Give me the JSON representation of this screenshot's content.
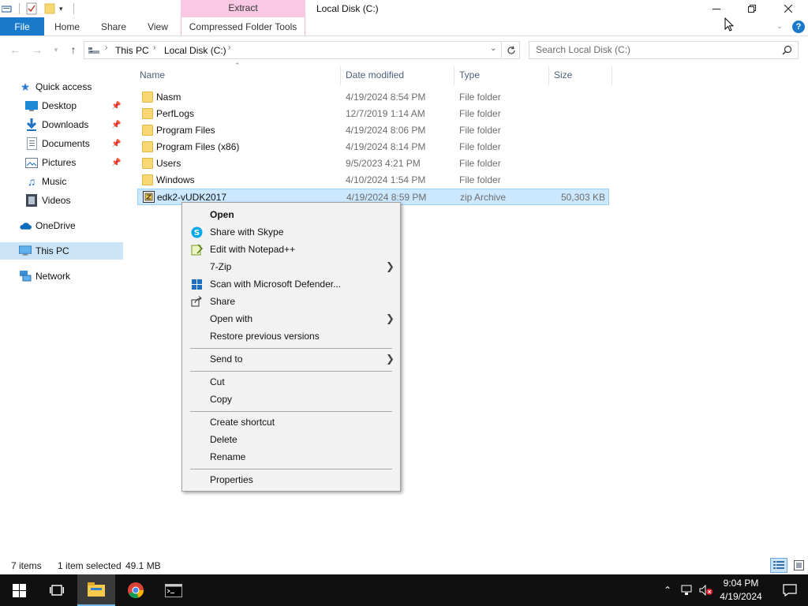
{
  "window": {
    "title": "Local Disk (C:)",
    "contextual_group": "Extract"
  },
  "ribbon": {
    "tabs": [
      {
        "label": "File"
      },
      {
        "label": "Home"
      },
      {
        "label": "Share"
      },
      {
        "label": "View"
      },
      {
        "label": "Compressed Folder Tools"
      }
    ]
  },
  "address": {
    "segments": [
      "This PC",
      "Local Disk (C:)"
    ]
  },
  "search": {
    "placeholder": "Search Local Disk (C:)"
  },
  "columns": {
    "name": "Name",
    "date": "Date modified",
    "type": "Type",
    "size": "Size"
  },
  "nav": {
    "quick_access": "Quick access",
    "items": [
      {
        "label": "Desktop",
        "icon": "desktop-icon"
      },
      {
        "label": "Downloads",
        "icon": "downloads-icon"
      },
      {
        "label": "Documents",
        "icon": "documents-icon"
      },
      {
        "label": "Pictures",
        "icon": "pictures-icon"
      },
      {
        "label": "Music",
        "icon": "music-icon"
      },
      {
        "label": "Videos",
        "icon": "videos-icon"
      }
    ],
    "onedrive": "OneDrive",
    "this_pc": "This PC",
    "network": "Network"
  },
  "files": [
    {
      "name": "Nasm",
      "date": "4/19/2024 8:54 PM",
      "type": "File folder",
      "size": ""
    },
    {
      "name": "PerfLogs",
      "date": "12/7/2019 1:14 AM",
      "type": "File folder",
      "size": ""
    },
    {
      "name": "Program Files",
      "date": "4/19/2024 8:06 PM",
      "type": "File folder",
      "size": ""
    },
    {
      "name": "Program Files (x86)",
      "date": "4/19/2024 8:14 PM",
      "type": "File folder",
      "size": ""
    },
    {
      "name": "Users",
      "date": "9/5/2023 4:21 PM",
      "type": "File folder",
      "size": ""
    },
    {
      "name": "Windows",
      "date": "4/10/2024 1:54 PM",
      "type": "File folder",
      "size": ""
    },
    {
      "name": "edk2-vUDK2017",
      "date": "4/19/2024 8:59 PM",
      "type": "zip Archive",
      "size": "50,303 KB"
    }
  ],
  "context_menu": {
    "open": "Open",
    "share_skype": "Share with Skype",
    "edit_notepad": "Edit with Notepad++",
    "seven_zip": "7-Zip",
    "scan_defender": "Scan with Microsoft Defender...",
    "share": "Share",
    "open_with": "Open with",
    "restore": "Restore previous versions",
    "send_to": "Send to",
    "cut": "Cut",
    "copy": "Copy",
    "create_shortcut": "Create shortcut",
    "delete": "Delete",
    "rename": "Rename",
    "properties": "Properties"
  },
  "status": {
    "items": "7 items",
    "selected": "1 item selected",
    "size": "49.1 MB"
  },
  "taskbar": {
    "time": "9:04 PM",
    "date": "4/19/2024"
  },
  "colors": {
    "accent": "#1979ca",
    "selection": "#cce8ff",
    "extract_tab": "#f9c9e4",
    "taskbar": "#101010"
  }
}
